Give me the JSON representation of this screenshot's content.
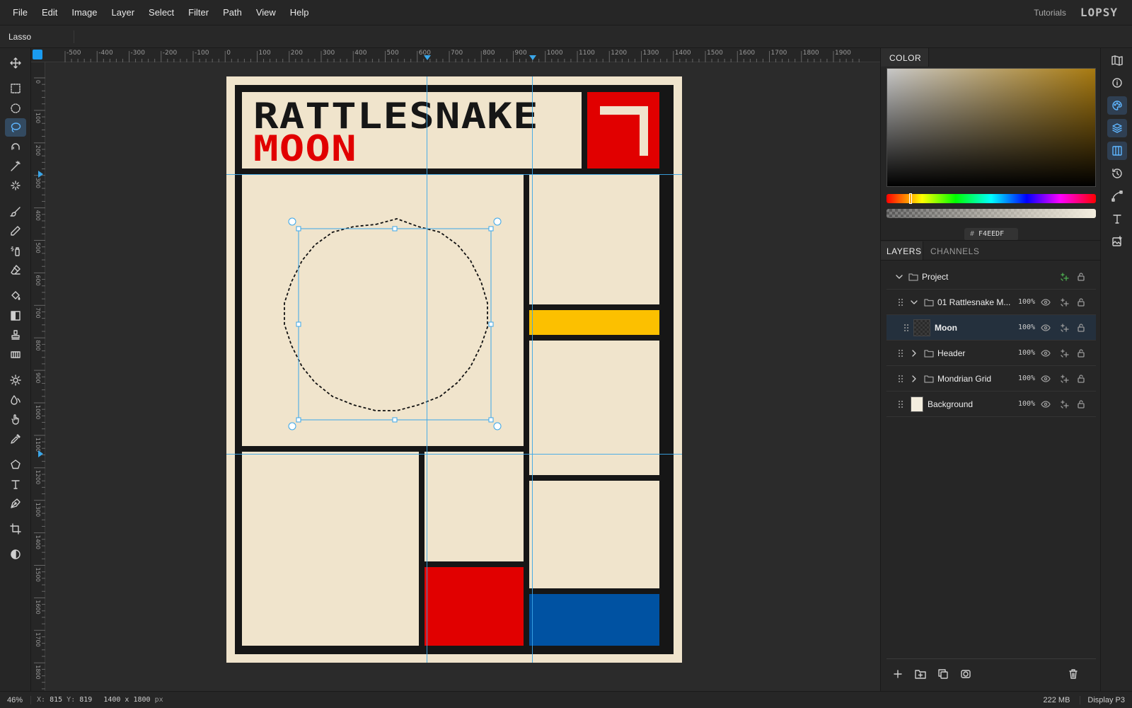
{
  "menubar": {
    "items": [
      "File",
      "Edit",
      "Image",
      "Layer",
      "Select",
      "Filter",
      "Path",
      "View",
      "Help"
    ],
    "tutorials": "Tutorials",
    "logo": "LOPSY"
  },
  "options": {
    "tool_name": "Lasso"
  },
  "rulers": {
    "top": [
      "-500",
      "-400",
      "-300",
      "-200",
      "-100",
      "0",
      "100",
      "200",
      "300",
      "400",
      "500",
      "600",
      "700",
      "800",
      "900",
      "1000",
      "1100",
      "1200",
      "1300",
      "1400",
      "1500",
      "1600",
      "1700",
      "1800",
      "1900"
    ],
    "left": [
      "0",
      "100",
      "200",
      "300",
      "400",
      "500",
      "600",
      "700",
      "800",
      "900",
      "1000",
      "1100",
      "1200",
      "1300",
      "1400",
      "1500",
      "1600",
      "1700",
      "1800"
    ]
  },
  "poster": {
    "title": "RATTLESNAKE",
    "subtitle": "MOON"
  },
  "colors": {
    "cream": "#F0E4CC",
    "black": "#161616",
    "red": "#E10000",
    "yellow": "#FCC000",
    "blue": "#0052A2",
    "accent": "#1A9BF0"
  },
  "color_panel": {
    "title": "COLOR",
    "hex_prefix": "#",
    "hex_value": "F4EEDF"
  },
  "layers_panel": {
    "tabs": [
      "LAYERS",
      "CHANNELS"
    ],
    "layers": [
      {
        "name": "Project",
        "opacity": ""
      },
      {
        "name": "01 Rattlesnake M...",
        "opacity": "100%"
      },
      {
        "name": "Moon",
        "opacity": "100%"
      },
      {
        "name": "Header",
        "opacity": "100%"
      },
      {
        "name": "Mondrian Grid",
        "opacity": "100%"
      },
      {
        "name": "Background",
        "opacity": "100%"
      }
    ]
  },
  "status": {
    "zoom": "46%",
    "x_label": "X:",
    "x": "815",
    "y_label": "Y:",
    "y": "819",
    "doc_size": "1400 x 1800",
    "doc_unit": "px",
    "memory": "222 MB",
    "profile": "Display P3"
  }
}
